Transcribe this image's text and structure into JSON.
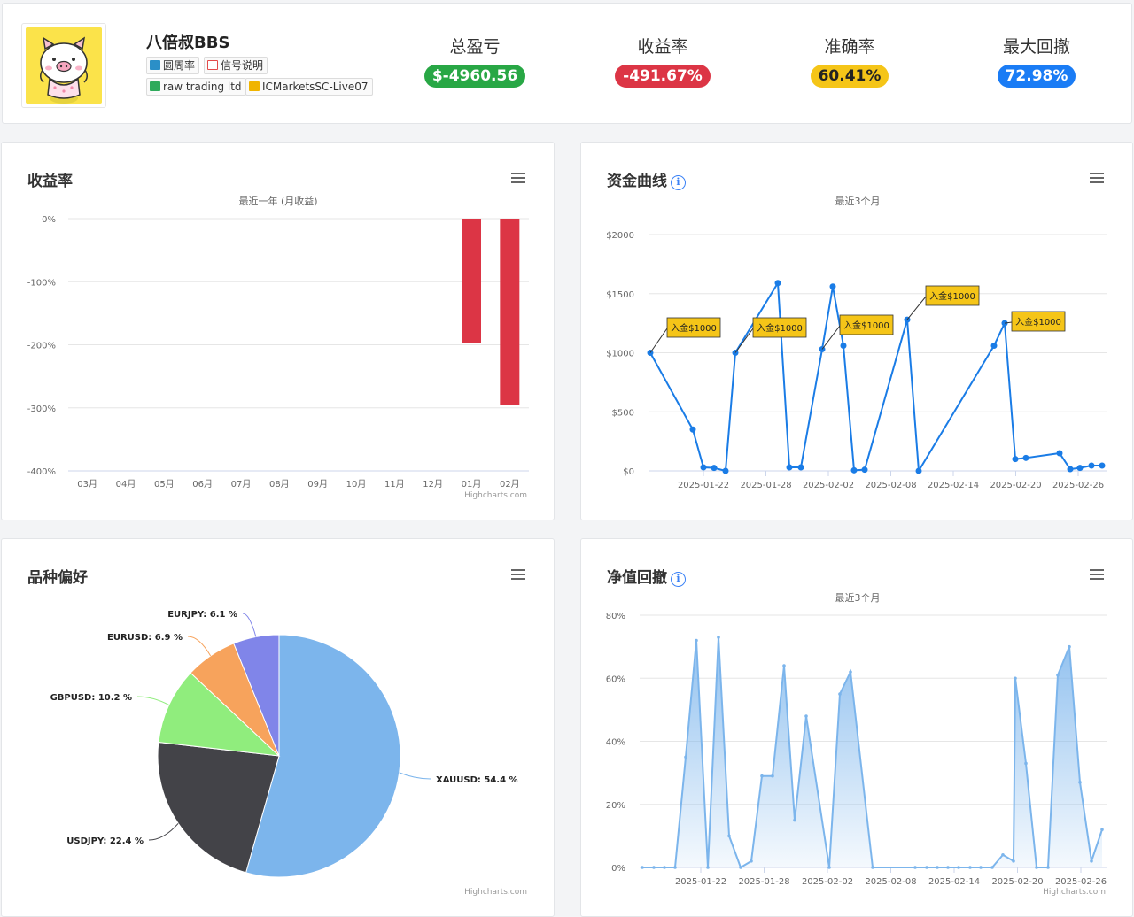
{
  "profile": {
    "name": "八倍叔BBS",
    "tags": [
      "圆周率",
      "信号说明",
      "raw trading ltd",
      "ICMarketsSC-Live07"
    ]
  },
  "stats": [
    {
      "label": "总盈亏",
      "value": "$-4960.56",
      "color": "#28a745"
    },
    {
      "label": "收益率",
      "value": "-491.67%",
      "color": "#dc3545"
    },
    {
      "label": "准确率",
      "value": "60.41%",
      "color": "#f5c518"
    },
    {
      "label": "最大回撤",
      "value": "72.98%",
      "color": "#1a7cf5"
    }
  ],
  "credit": "Highcharts.com",
  "chart_data": [
    {
      "type": "bar",
      "title": "收益率",
      "subtitle": "最近一年 (月收益)",
      "categories": [
        "03月",
        "04月",
        "05月",
        "06月",
        "07月",
        "08月",
        "09月",
        "10月",
        "11月",
        "12月",
        "01月",
        "02月"
      ],
      "values": [
        0,
        0,
        0,
        0,
        0,
        0,
        0,
        0,
        0,
        0,
        -197,
        -295
      ],
      "ylim": [
        -400,
        0
      ],
      "yticks": [
        "0%",
        "-100%",
        "-200%",
        "-300%",
        "-400%"
      ],
      "color": "#dc3545"
    },
    {
      "type": "line",
      "title": "资金曲线",
      "subtitle": "最近3个月",
      "xticks": [
        "2025-01-22",
        "2025-01-28",
        "2025-02-02",
        "2025-02-08",
        "2025-02-14",
        "2025-02-20",
        "2025-02-26"
      ],
      "yticks": [
        "$2000",
        "$1500",
        "$1000",
        "$500",
        "$0"
      ],
      "ylim": [
        0,
        2000
      ],
      "series": [
        {
          "values": [
            1000,
            350,
            30,
            25,
            0,
            1000,
            1590,
            30,
            30,
            1030,
            1560,
            1060,
            5,
            10,
            1280,
            0,
            1060,
            1250,
            100,
            110,
            150,
            15,
            25,
            45,
            45
          ]
        }
      ],
      "annotations": [
        "入金$1000",
        "入金$1000",
        "入金$1000",
        "入金$1000",
        "入金$1000"
      ],
      "color": "#1a7ce6"
    },
    {
      "type": "pie",
      "title": "品种偏好",
      "slices": [
        {
          "name": "XAUUSD",
          "value": 54.4,
          "label": "XAUUSD: 54.4 %",
          "color": "#7cb5ec"
        },
        {
          "name": "USDJPY",
          "value": 22.4,
          "label": "USDJPY: 22.4 %",
          "color": "#434348"
        },
        {
          "name": "GBPUSD",
          "value": 10.2,
          "label": "GBPUSD: 10.2 %",
          "color": "#90ed7d"
        },
        {
          "name": "EURUSD",
          "value": 6.9,
          "label": "EURUSD: 6.9 %",
          "color": "#f7a35c"
        },
        {
          "name": "EURJPY",
          "value": 6.1,
          "label": "EURJPY: 6.1 %",
          "color": "#8085e9"
        }
      ]
    },
    {
      "type": "area",
      "title": "净值回撤",
      "subtitle": "最近3个月",
      "xticks": [
        "2025-01-22",
        "2025-01-28",
        "2025-02-02",
        "2025-02-08",
        "2025-02-14",
        "2025-02-20",
        "2025-02-26"
      ],
      "yticks": [
        "80%",
        "60%",
        "40%",
        "20%",
        "0%"
      ],
      "ylim": [
        0,
        80
      ],
      "series": [
        {
          "values": [
            0,
            0,
            0,
            0,
            35,
            72,
            0,
            73,
            10,
            0,
            2,
            29,
            29,
            64,
            15,
            48,
            0,
            55,
            62,
            0,
            0,
            0,
            0,
            0,
            0,
            0,
            0,
            0,
            4,
            2,
            60,
            33,
            0,
            0,
            61,
            70,
            27,
            2,
            12
          ]
        }
      ],
      "color": "#7cb5ec"
    }
  ]
}
